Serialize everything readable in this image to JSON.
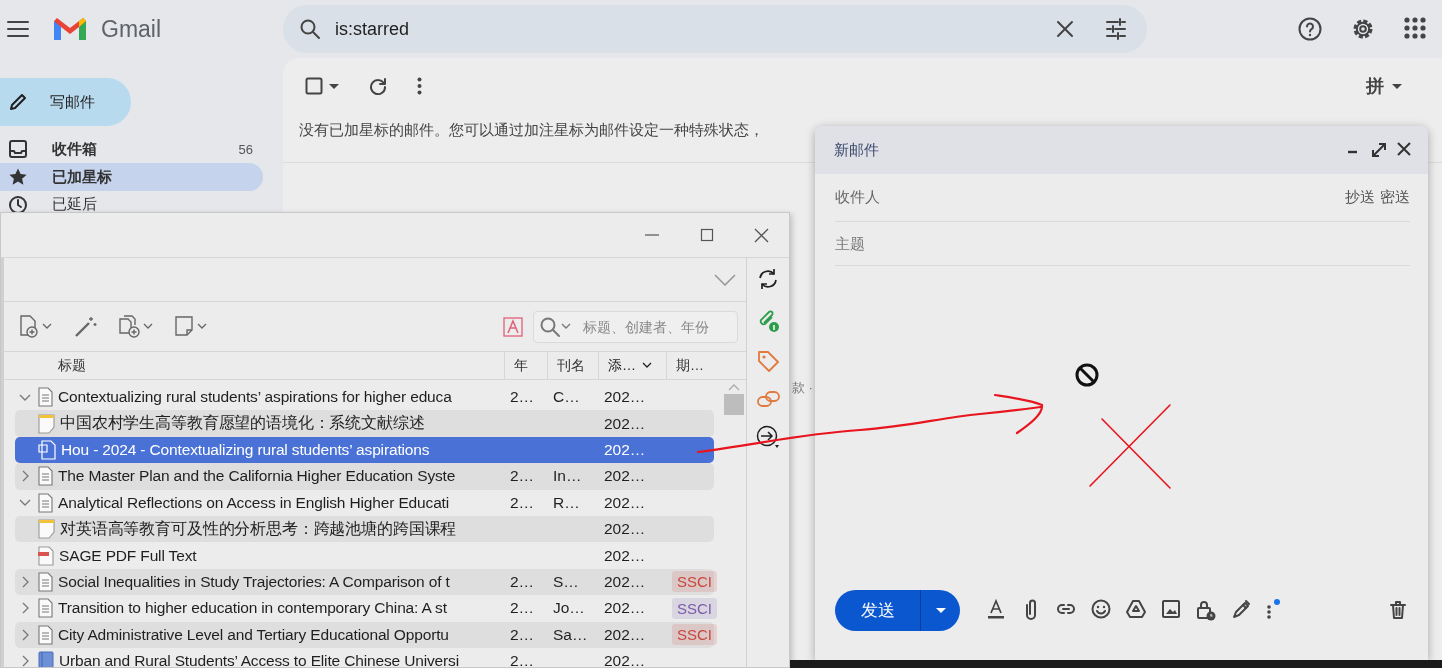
{
  "gmail": {
    "app_name": "Gmail",
    "search": {
      "value": "is:starred"
    },
    "compose_label": "写邮件",
    "nav": [
      {
        "label": "收件箱",
        "count": "56",
        "selected": false
      },
      {
        "label": "已加星标",
        "selected": true
      },
      {
        "label": "已延后",
        "selected": false
      }
    ],
    "input_method": "拼",
    "empty_message": "没有已加星标的邮件。您可以通过加注星标为邮件设定一种特殊状态，",
    "peek_text": "款 ·"
  },
  "zotero": {
    "search": {
      "placeholder": "标题、创建者、年份"
    },
    "columns": [
      {
        "label": "标题",
        "sorted": false
      },
      {
        "label": "年",
        "sorted": false
      },
      {
        "label": "刊名",
        "sorted": false
      },
      {
        "label": "添…",
        "sorted": true
      },
      {
        "label": "期…",
        "sorted": false
      }
    ],
    "rows": [
      {
        "kind": "document",
        "title": "Contextualizing rural students’ aspirations for higher educa",
        "year": "2…",
        "publication": "C…",
        "added": "202…",
        "selected": false,
        "expanded": true,
        "children": [
          {
            "kind": "note",
            "title": "中国农村学生高等教育愿望的语境化：系统文献综述",
            "added": "202…",
            "selected": false
          },
          {
            "kind": "note-file",
            "title": "Hou - 2024 - Contextualizing rural students’ aspirations",
            "added": "202…",
            "selected": true
          }
        ]
      },
      {
        "kind": "document",
        "title": "The Master Plan and the California Higher Education Syste",
        "year": "2…",
        "publication": "In…",
        "added": "202…",
        "selected": false,
        "expanded": false
      },
      {
        "kind": "document",
        "title": "Analytical Reflections on Access in English Higher Educati",
        "year": "2…",
        "publication": "R…",
        "added": "202…",
        "selected": false,
        "expanded": true,
        "children": [
          {
            "kind": "note",
            "title": "对英语高等教育可及性的分析思考：跨越池塘的跨国课程",
            "added": "202…",
            "selected": false
          },
          {
            "kind": "pdf",
            "title": "SAGE PDF Full Text",
            "added": "202…",
            "selected": false
          }
        ]
      },
      {
        "kind": "document",
        "title": "Social Inequalities in Study Trajectories: A Comparison of t",
        "year": "2…",
        "publication": "S…",
        "added": "202…",
        "selected": false,
        "expanded": false,
        "tag": {
          "text": "SSCI",
          "color": "#c9463d"
        }
      },
      {
        "kind": "document",
        "title": "Transition to higher education in contemporary China: A st",
        "year": "2…",
        "publication": "Jo…",
        "added": "202…",
        "selected": false,
        "expanded": false,
        "tag": {
          "text": "SSCI",
          "color": "#7a5ba8"
        }
      },
      {
        "kind": "document",
        "title": "City Administrative Level and Tertiary Educational Opportu",
        "year": "2…",
        "publication": "Sa…",
        "added": "202…",
        "selected": false,
        "expanded": false,
        "tag": {
          "text": "SSCI",
          "color": "#c9463d"
        }
      },
      {
        "kind": "book",
        "title": "Urban and Rural Students’ Access to Elite Chinese Universi",
        "year": "2…",
        "added": "202…",
        "selected": false,
        "expanded": false
      }
    ]
  },
  "compose": {
    "title": "新邮件",
    "to_label": "收件人",
    "cc": "抄送",
    "bcc": "密送",
    "subject_placeholder": "主题",
    "send": "发送"
  }
}
